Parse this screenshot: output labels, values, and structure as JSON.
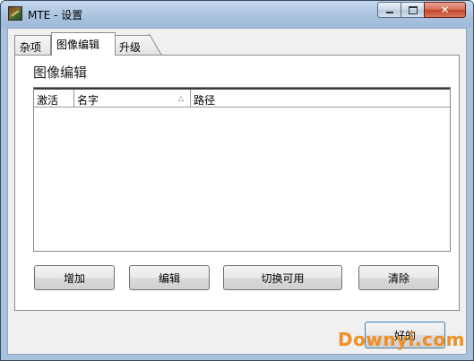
{
  "window": {
    "title": "MTE - 设置",
    "app_icon": "app-icon",
    "controls": {
      "minimize": "minimize-icon",
      "maximize": "maximize-icon",
      "close": "close-icon"
    }
  },
  "tabs": [
    {
      "label": "杂项",
      "selected": false
    },
    {
      "label": "图像编辑",
      "selected": true
    },
    {
      "label": "升级",
      "selected": false
    }
  ],
  "panel": {
    "group_title": "图像编辑",
    "list": {
      "columns": [
        "激活",
        "名字",
        "路径"
      ],
      "sorted_column": "名字",
      "sort_icon_glyph": "△",
      "rows": []
    },
    "buttons": {
      "add": "增加",
      "edit": "编辑",
      "toggle": "切换可用",
      "clear": "清除"
    }
  },
  "footer": {
    "ok_label": "好的"
  },
  "watermark": "Downyi.com",
  "colors": {
    "titlebar": "#a8c2de",
    "close_button": "#c0432a",
    "watermark": "#f08a1c"
  }
}
